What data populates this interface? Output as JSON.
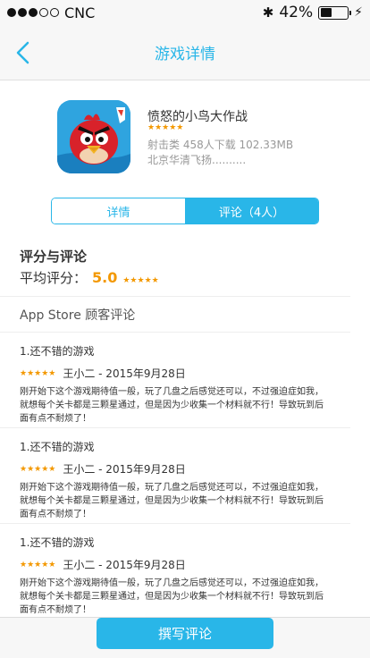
{
  "status": {
    "carrier": "CNC",
    "battery_percent": "42%",
    "battery_level": 0.42,
    "signal_filled": 3,
    "signal_total": 5
  },
  "nav": {
    "title": "游戏详情"
  },
  "app": {
    "name": "愤怒的小鸟大作战",
    "stars": "★★★★★",
    "meta_line1": "射击类 458人下载 102.33MB",
    "meta_line2": "北京华清飞扬..........",
    "icon": "angry-bird-icon"
  },
  "tabs": {
    "details": "详情",
    "reviews": "评论（4人）",
    "active": "reviews"
  },
  "ratings": {
    "title": "评分与评论",
    "avg_label": "平均评分：",
    "avg_value": "5.0",
    "avg_stars": "★★★★★",
    "appstore_title": "App Store 顾客评论"
  },
  "reviews": [
    {
      "title": "1.还不错的游戏",
      "stars": "★★★★★",
      "byline": "王小二 - 2015年9月28日",
      "body": "刚开始下这个游戏期待值一般，玩了几盘之后感觉还可以，不过强迫症如我，就想每个关卡都是三颗星通过，但是因为少收集一个材料就不行！导致玩到后面有点不耐烦了！"
    },
    {
      "title": "1.还不错的游戏",
      "stars": "★★★★★",
      "byline": "王小二 - 2015年9月28日",
      "body": "刚开始下这个游戏期待值一般，玩了几盘之后感觉还可以，不过强迫症如我，就想每个关卡都是三颗星通过，但是因为少收集一个材料就不行！导致玩到后面有点不耐烦了！"
    },
    {
      "title": "1.还不错的游戏",
      "stars": "★★★★★",
      "byline": "王小二 - 2015年9月28日",
      "body": "刚开始下这个游戏期待值一般，玩了几盘之后感觉还可以，不过强迫症如我，就想每个关卡都是三颗星通过，但是因为少收集一个材料就不行！导致玩到后面有点不耐烦了！"
    }
  ],
  "footer": {
    "write_button": "撰写评论"
  },
  "colors": {
    "accent": "#29b6e8",
    "star": "#f39800"
  }
}
